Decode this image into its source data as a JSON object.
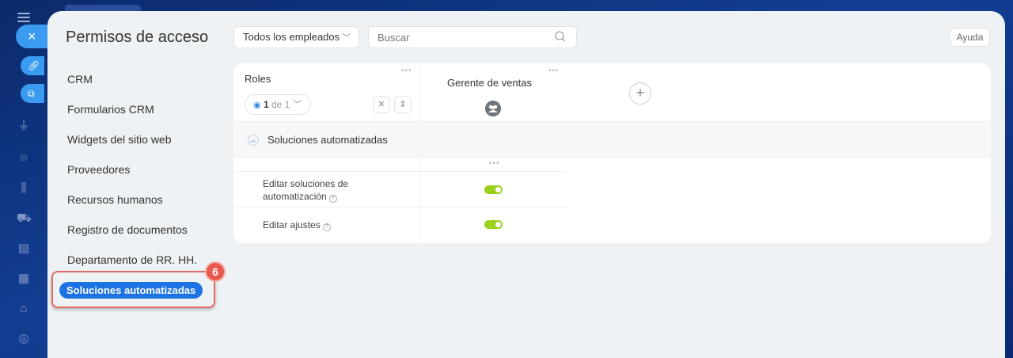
{
  "header": {
    "title": "Permisos de acceso",
    "filter_label": "Todos los empleados",
    "search_placeholder": "Buscar",
    "help_label": "Ayuda"
  },
  "sidebar": {
    "items": [
      {
        "label": "CRM"
      },
      {
        "label": "Formularios CRM"
      },
      {
        "label": "Widgets del sitio web"
      },
      {
        "label": "Proveedores"
      },
      {
        "label": "Recursos humanos"
      },
      {
        "label": "Registro de documentos"
      },
      {
        "label": "Departamento de RR. HH."
      },
      {
        "label": "Soluciones automatizadas"
      }
    ],
    "active_index": 7,
    "step_badge": "6"
  },
  "table": {
    "roles_header": "Roles",
    "pager": {
      "current": "1",
      "of_text": "de 1"
    },
    "role_columns": [
      {
        "name": "Gerente de ventas"
      }
    ],
    "section": "Soluciones automatizadas",
    "permissions": [
      {
        "label": "Editar soluciones de automatización",
        "enabled": true
      },
      {
        "label": "Editar ajustes",
        "enabled": true
      }
    ]
  },
  "colors": {
    "accent": "#1d73e3",
    "toggle_on": "#9bd11c",
    "highlight": "#e46b63"
  }
}
